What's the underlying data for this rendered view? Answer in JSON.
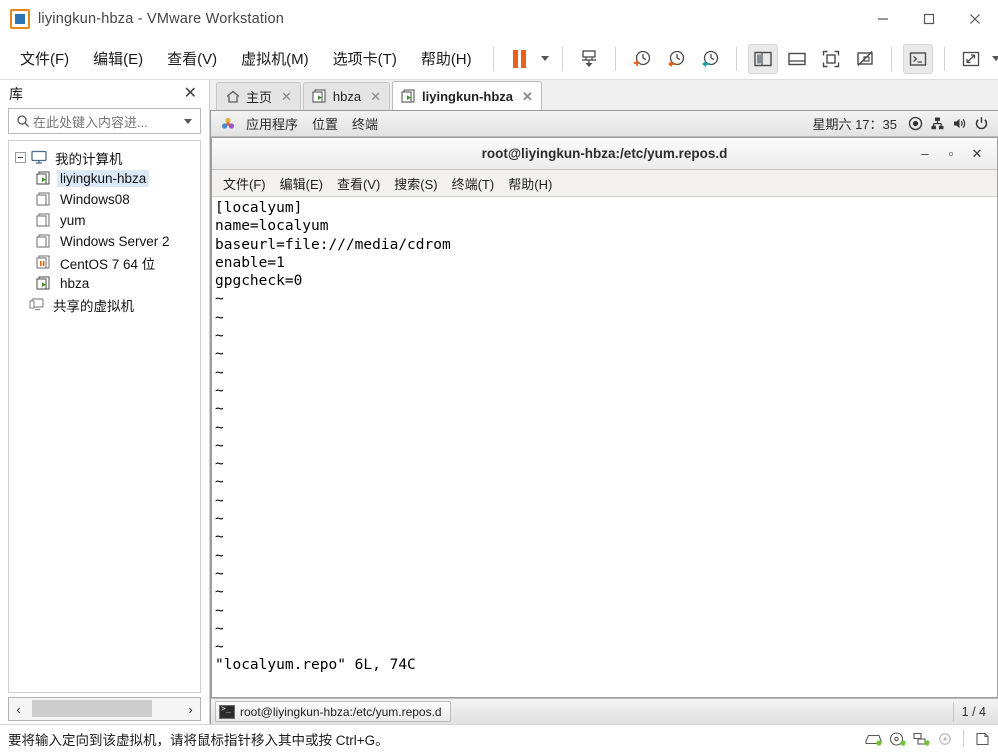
{
  "window": {
    "title": "liyingkun-hbza - VMware Workstation",
    "app_icon": "vmware-logo-icon",
    "controls": {
      "minimize": "—",
      "maximize": "☐",
      "close": "✕"
    }
  },
  "menubar": {
    "items": [
      {
        "label": "文件(F)",
        "name": "menu-file"
      },
      {
        "label": "编辑(E)",
        "name": "menu-edit"
      },
      {
        "label": "查看(V)",
        "name": "menu-view"
      },
      {
        "label": "虚拟机(M)",
        "name": "menu-vm"
      },
      {
        "label": "选项卡(T)",
        "name": "menu-tabs"
      },
      {
        "label": "帮助(H)",
        "name": "menu-help"
      }
    ],
    "toolbar": [
      {
        "name": "suspend-button",
        "icon": "pause-icon"
      },
      {
        "name": "power-dropdown",
        "icon": "chevron-down-icon"
      },
      {
        "name": "send-ctrl-alt-del-button",
        "icon": "send-keys-icon"
      },
      {
        "name": "snapshot-take-button",
        "icon": "snapshot-plus-icon"
      },
      {
        "name": "snapshot-revert-button",
        "icon": "snapshot-revert-icon"
      },
      {
        "name": "snapshot-manager-button",
        "icon": "snapshot-manager-icon"
      },
      {
        "name": "show-library-button",
        "icon": "library-panel-icon"
      },
      {
        "name": "show-thumbnail-bar-button",
        "icon": "thumbnail-bar-icon"
      },
      {
        "name": "full-screen-button",
        "icon": "fullscreen-icon"
      },
      {
        "name": "unity-mode-button",
        "icon": "unity-mode-icon"
      },
      {
        "name": "console-view-button",
        "icon": "terminal-icon"
      },
      {
        "name": "stretch-guest-button",
        "icon": "stretch-icon"
      },
      {
        "name": "stretch-dropdown",
        "icon": "chevron-down-icon"
      }
    ]
  },
  "sidebar": {
    "title": "库",
    "close_label": "✕",
    "search": {
      "placeholder": "在此处键入内容进...",
      "value": ""
    },
    "tree": [
      {
        "label": "我的计算机",
        "icon": "computer-icon",
        "level": 0,
        "expander": true,
        "selected": false
      },
      {
        "label": "liyingkun-hbza",
        "icon": "vm-running-icon",
        "level": 1,
        "expander": false,
        "selected": true
      },
      {
        "label": "Windows08",
        "icon": "vm-off-icon",
        "level": 1,
        "expander": false,
        "selected": false
      },
      {
        "label": "yum",
        "icon": "vm-off-icon",
        "level": 1,
        "expander": false,
        "selected": false
      },
      {
        "label": "Windows Server 2",
        "icon": "vm-off-icon",
        "level": 1,
        "expander": false,
        "selected": false
      },
      {
        "label": "CentOS 7 64 位",
        "icon": "vm-suspended-icon",
        "level": 1,
        "expander": false,
        "selected": false
      },
      {
        "label": "hbza",
        "icon": "vm-running-icon",
        "level": 1,
        "expander": false,
        "selected": false
      },
      {
        "label": "共享的虚拟机",
        "icon": "shared-vms-icon",
        "level": 0,
        "expander": false,
        "selected": false
      }
    ],
    "hscroll": {
      "left": "‹",
      "right": "›"
    }
  },
  "tabs": [
    {
      "label": "主页",
      "icon": "home-icon",
      "active": false,
      "close": "✕"
    },
    {
      "label": "hbza",
      "icon": "vm-running-icon",
      "active": false,
      "close": "✕"
    },
    {
      "label": "liyingkun-hbza",
      "icon": "vm-running-icon",
      "active": true,
      "close": "✕"
    }
  ],
  "guest": {
    "top_panel": {
      "menus": [
        {
          "label": "应用程序",
          "name": "gnome-applications-menu",
          "icon": "applications-icon"
        },
        {
          "label": "位置",
          "name": "gnome-places-menu",
          "icon": ""
        },
        {
          "label": "终端",
          "name": "gnome-terminal-menu",
          "icon": ""
        }
      ],
      "clock": "星期六 17：35",
      "tray": [
        {
          "name": "accessibility-icon"
        },
        {
          "name": "network-icon"
        },
        {
          "name": "volume-icon"
        },
        {
          "name": "power-menu-icon"
        }
      ]
    },
    "terminal": {
      "title": "root@liyingkun-hbza:/etc/yum.repos.d",
      "controls": {
        "minimize": "–",
        "maximize": "▫",
        "close": "✕"
      },
      "menus": [
        {
          "label": "文件(F)",
          "name": "term-menu-file"
        },
        {
          "label": "编辑(E)",
          "name": "term-menu-edit"
        },
        {
          "label": "查看(V)",
          "name": "term-menu-view"
        },
        {
          "label": "搜索(S)",
          "name": "term-menu-search"
        },
        {
          "label": "终端(T)",
          "name": "term-menu-terminal"
        },
        {
          "label": "帮助(H)",
          "name": "term-menu-help"
        }
      ],
      "content_lines": [
        "[localyum]",
        "name=localyum",
        "baseurl=file:///media/cdrom",
        "enable=1",
        "gpgcheck=0"
      ],
      "tilde_count": 20,
      "tilde_char": "~",
      "status_line": "\"localyum.repo\" 6L, 74C"
    },
    "taskbar": {
      "task_label": "root@liyingkun-hbza:/etc/yum.repos.d",
      "task_icon": "terminal-icon",
      "workspace": "1 / 4"
    }
  },
  "statusbar": {
    "message": "要将输入定向到该虚拟机，请将鼠标指针移入其中或按 Ctrl+G。",
    "devices": [
      {
        "name": "hard-disk-icon"
      },
      {
        "name": "cd-dvd-icon"
      },
      {
        "name": "network-adapter-icon"
      },
      {
        "name": "sound-card-icon"
      },
      {
        "name": "printer-icon"
      }
    ]
  },
  "colors": {
    "accent_orange": "#e8601a",
    "accent_blue": "#2e72b8",
    "running_green": "#3a9a23",
    "selection_blue": "#dbe9f7"
  }
}
